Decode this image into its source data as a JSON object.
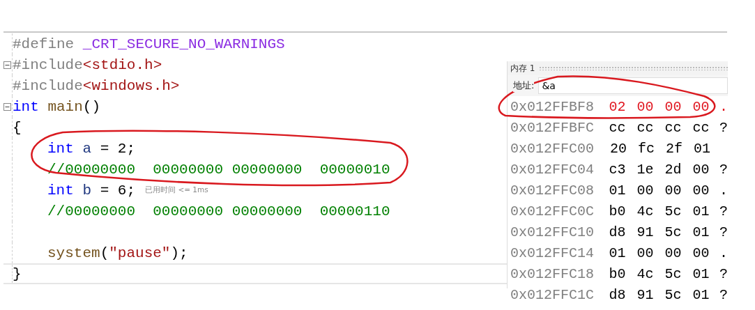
{
  "editor": {
    "lines": [
      {
        "fold": false,
        "current": false,
        "tokens": [
          {
            "kind": "pre",
            "text": "#define "
          },
          {
            "kind": "macro",
            "text": "_CRT_SECURE_NO_WARNINGS"
          }
        ]
      },
      {
        "fold": true,
        "current": false,
        "tokens": [
          {
            "kind": "pre",
            "text": "#include"
          },
          {
            "kind": "string",
            "text": "<stdio.h>"
          }
        ]
      },
      {
        "fold": false,
        "current": false,
        "tokens": [
          {
            "kind": "pre",
            "text": "#include"
          },
          {
            "kind": "string",
            "text": "<windows.h>"
          }
        ]
      },
      {
        "fold": true,
        "current": false,
        "tokens": [
          {
            "kind": "keyword",
            "text": "int"
          },
          {
            "kind": "func",
            "text": " main"
          },
          {
            "kind": "plain",
            "text": "()"
          }
        ]
      },
      {
        "fold": false,
        "current": false,
        "tokens": [
          {
            "kind": "plain",
            "text": "{"
          }
        ]
      },
      {
        "fold": false,
        "current": false,
        "indent": true,
        "tokens": [
          {
            "kind": "keyword",
            "text": "int"
          },
          {
            "kind": "var",
            "text": " a"
          },
          {
            "kind": "plain",
            "text": " = 2;"
          }
        ]
      },
      {
        "fold": false,
        "current": false,
        "indent": true,
        "tokens": [
          {
            "kind": "comment",
            "text": "//00000000  00000000 00000000  00000010"
          }
        ]
      },
      {
        "fold": false,
        "current": false,
        "indent": true,
        "tokens": [
          {
            "kind": "keyword",
            "text": "int"
          },
          {
            "kind": "var",
            "text": " b"
          },
          {
            "kind": "plain",
            "text": " = 6;"
          }
        ],
        "hint": "已用时间 <= 1ms"
      },
      {
        "fold": false,
        "current": false,
        "indent": true,
        "tokens": [
          {
            "kind": "comment",
            "text": "//00000000  00000000 00000000  00000110"
          }
        ]
      },
      {
        "fold": false,
        "current": false
      },
      {
        "fold": false,
        "current": false,
        "indent": true,
        "tokens": [
          {
            "kind": "func",
            "text": "system"
          },
          {
            "kind": "plain",
            "text": "("
          },
          {
            "kind": "string",
            "text": "\"pause\""
          },
          {
            "kind": "plain",
            "text": ");"
          }
        ]
      },
      {
        "fold": false,
        "current": true,
        "tokens": [
          {
            "kind": "plain",
            "text": "}"
          }
        ]
      }
    ]
  },
  "memory_window": {
    "title": "内存 1",
    "address_label": "地址:",
    "address_value": "&a",
    "rows": [
      {
        "address": "0x012FFBF8",
        "bytes": "02 00 00 00",
        "ascii": ".",
        "changed": true
      },
      {
        "address": "0x012FFBFC",
        "bytes": "cc cc cc cc",
        "ascii": "?",
        "changed": false
      },
      {
        "address": "0x012FFC00",
        "bytes": "20 fc 2f 01",
        "changed": false
      },
      {
        "address": "0x012FFC04",
        "bytes": "c3 1e 2d 00",
        "ascii": "?",
        "changed": false
      },
      {
        "address": "0x012FFC08",
        "bytes": "01 00 00 00",
        "ascii": ".",
        "changed": false
      },
      {
        "address": "0x012FFC0C",
        "bytes": "b0 4c 5c 01",
        "ascii": "?",
        "changed": false
      },
      {
        "address": "0x012FFC10",
        "bytes": "d8 91 5c 01",
        "ascii": "?",
        "changed": false
      },
      {
        "address": "0x012FFC14",
        "bytes": "01 00 00 00",
        "ascii": ".",
        "changed": false
      },
      {
        "address": "0x012FFC18",
        "bytes": "b0 4c 5c 01",
        "ascii": "?",
        "changed": false
      },
      {
        "address": "0x012FFC1C",
        "bytes": "d8 91 5c 01",
        "ascii": "?",
        "changed": false
      }
    ]
  }
}
